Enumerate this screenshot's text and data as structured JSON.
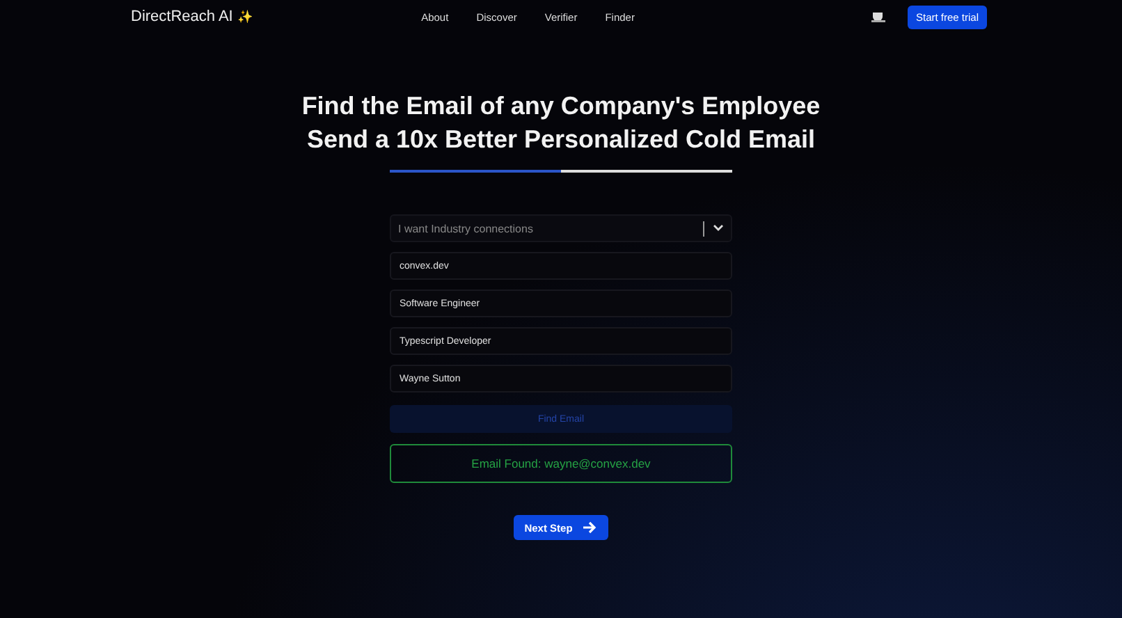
{
  "nav": {
    "brand": "DirectReach AI",
    "brand_mark": "✨",
    "links": [
      "About",
      "Discover",
      "Verifier",
      "Finder"
    ],
    "cta": "Start free trial"
  },
  "hero": {
    "lines": [
      "Find the Email of any Company's Employee",
      "Send a 10x Better Personalized Cold Email"
    ]
  },
  "progress": {
    "level": 0.5
  },
  "form": {
    "goal": {
      "value": "I want Industry connections"
    },
    "fields": [
      {
        "value": "convex.dev"
      },
      {
        "value": "Software Engineer"
      },
      {
        "value": "Typescript Developer"
      },
      {
        "value": "Wayne Sutton"
      }
    ],
    "submit": {
      "label": "Find Email",
      "disabled": true
    },
    "result": "Email Found: wayne@convex.dev",
    "next": "Next Step"
  }
}
